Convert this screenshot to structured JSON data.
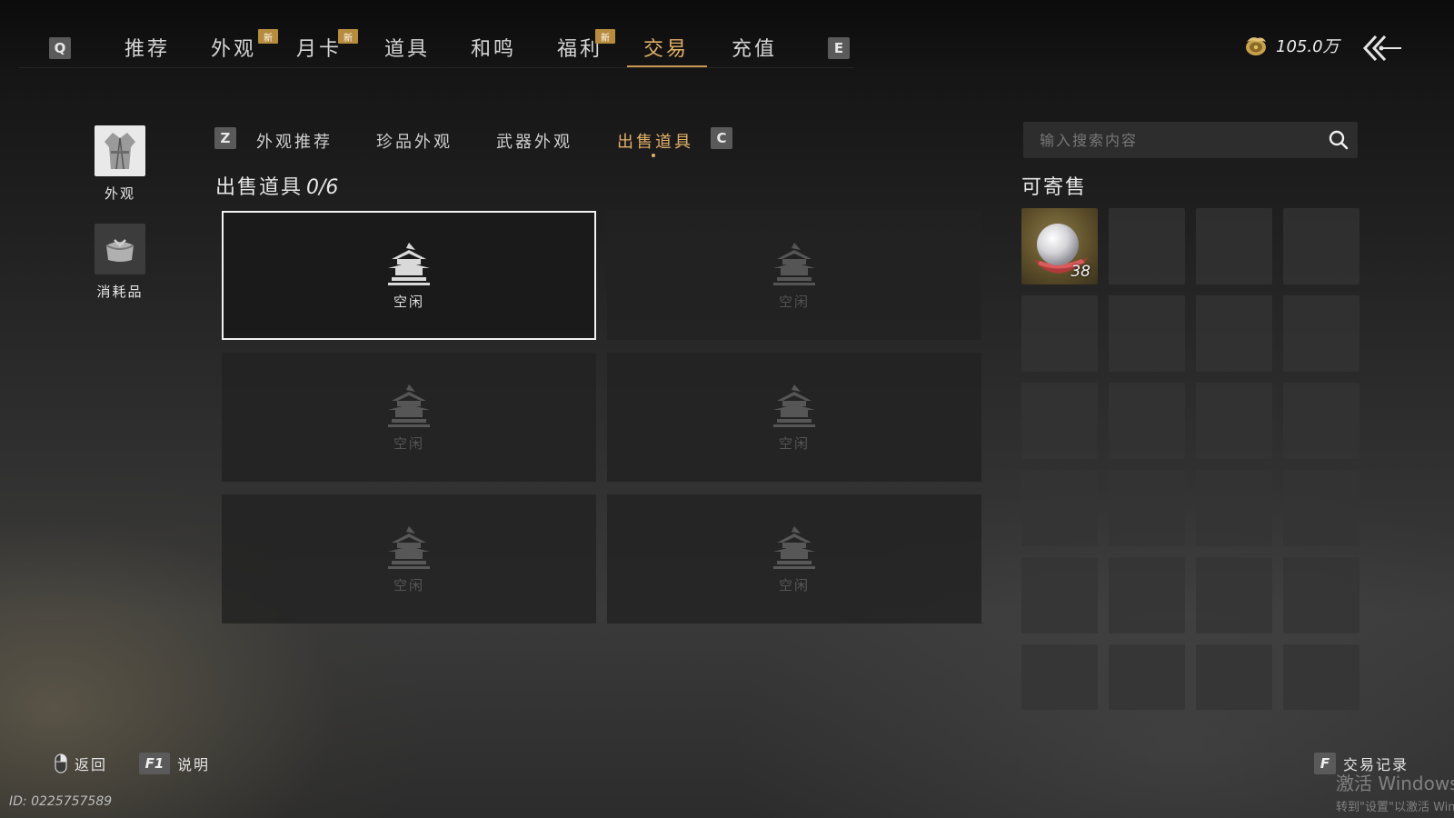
{
  "top_nav": {
    "left_key": "Q",
    "right_key": "E",
    "new_badge_label": "新",
    "tabs": [
      {
        "label": "推荐",
        "new": false,
        "active": false
      },
      {
        "label": "外观",
        "new": true,
        "active": false
      },
      {
        "label": "月卡",
        "new": true,
        "active": false
      },
      {
        "label": "道具",
        "new": false,
        "active": false
      },
      {
        "label": "和鸣",
        "new": false,
        "active": false
      },
      {
        "label": "福利",
        "new": true,
        "active": false
      },
      {
        "label": "交易",
        "new": false,
        "active": true
      },
      {
        "label": "充值",
        "new": false,
        "active": false
      }
    ],
    "currency_amount": "105.0万",
    "colors": {
      "accent": "#e2b167",
      "badge": "#b78c3c"
    }
  },
  "sidebar": {
    "categories": [
      {
        "label": "外观",
        "icon": "robe-icon",
        "active": true
      },
      {
        "label": "消耗品",
        "icon": "bundle-icon",
        "active": false
      }
    ]
  },
  "sub_tabs": {
    "left_key": "Z",
    "right_key": "C",
    "items": [
      {
        "label": "外观推荐",
        "active": false
      },
      {
        "label": "珍品外观",
        "active": false
      },
      {
        "label": "武器外观",
        "active": false
      },
      {
        "label": "出售道具",
        "active": true
      }
    ]
  },
  "sell_section": {
    "title": "出售道具",
    "count": "0/6",
    "slots": [
      {
        "label": "空闲",
        "selected": true
      },
      {
        "label": "空闲",
        "selected": false
      },
      {
        "label": "空闲",
        "selected": false
      },
      {
        "label": "空闲",
        "selected": false
      },
      {
        "label": "空闲",
        "selected": false
      },
      {
        "label": "空闲",
        "selected": false
      }
    ]
  },
  "search": {
    "placeholder": "输入搜索内容",
    "value": ""
  },
  "available": {
    "title": "可寄售",
    "items": [
      {
        "name": "pearl-item-icon",
        "count": "38"
      }
    ],
    "empty_cells": 23
  },
  "footer": {
    "back_label": "返回",
    "help_key": "F1",
    "help_label": "说明",
    "history_key": "F",
    "history_label": "交易记录",
    "user_id": "ID: 0225757589",
    "watermark_line1": "激活 Windows",
    "watermark_line2": "转到\"设置\"以激活 Windows。"
  }
}
